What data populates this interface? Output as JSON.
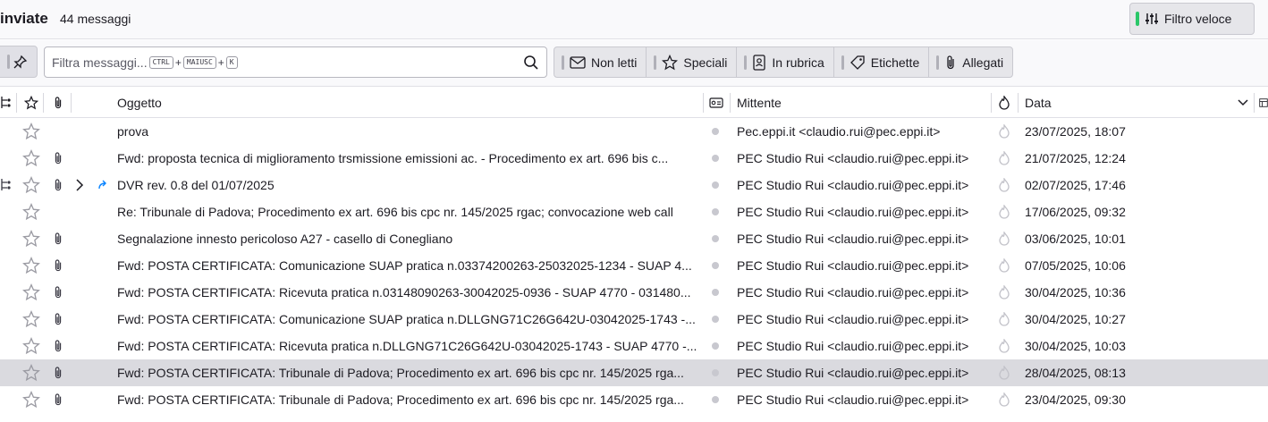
{
  "header": {
    "folder_name": "inviate",
    "message_count": "44 messaggi",
    "quick_filter_label": "Filtro veloce"
  },
  "filterbar": {
    "search_placeholder": "Filtra messaggi...",
    "shortcut_keys": [
      "CTRL",
      "MAIUSC",
      "K"
    ],
    "buttons": [
      {
        "label": "Non letti",
        "icon": "envelope-icon"
      },
      {
        "label": "Speciali",
        "icon": "star-icon"
      },
      {
        "label": "In rubrica",
        "icon": "contact-book-icon"
      },
      {
        "label": "Etichette",
        "icon": "tag-icon"
      },
      {
        "label": "Allegati",
        "icon": "paperclip-icon"
      }
    ]
  },
  "columns": {
    "subject": "Oggetto",
    "sender": "Mittente",
    "date": "Data"
  },
  "messages": [
    {
      "subject": "prova",
      "sender": "Pec.eppi.it <claudio.rui@pec.eppi.it>",
      "date": "23/07/2025, 18:07",
      "attachment": false,
      "selected": false
    },
    {
      "subject": "Fwd: proposta tecnica di miglioramento trsmissione emissioni ac. - Procedimento ex art. 696 bis c...",
      "sender": "PEC Studio Rui <claudio.rui@pec.eppi.it>",
      "date": "21/07/2025, 12:24",
      "attachment": true,
      "selected": false
    },
    {
      "subject": "DVR rev. 0.8 del 01/07/2025",
      "sender": "PEC Studio Rui <claudio.rui@pec.eppi.it>",
      "date": "02/07/2025, 17:46",
      "attachment": true,
      "selected": false,
      "thread": true,
      "forwarded": true
    },
    {
      "subject": "Re: Tribunale di Padova; Procedimento ex art. 696 bis cpc nr. 145/2025 rgac; convocazione web call",
      "sender": "PEC Studio Rui <claudio.rui@pec.eppi.it>",
      "date": "17/06/2025, 09:32",
      "attachment": false,
      "selected": false
    },
    {
      "subject": "Segnalazione innesto pericoloso A27 - casello di Conegliano",
      "sender": "PEC Studio Rui <claudio.rui@pec.eppi.it>",
      "date": "03/06/2025, 10:01",
      "attachment": true,
      "selected": false
    },
    {
      "subject": "Fwd: POSTA CERTIFICATA: Comunicazione SUAP pratica n.03374200263-25032025-1234 - SUAP 4...",
      "sender": "PEC Studio Rui <claudio.rui@pec.eppi.it>",
      "date": "07/05/2025, 10:06",
      "attachment": true,
      "selected": false
    },
    {
      "subject": "Fwd: POSTA CERTIFICATA: Ricevuta pratica n.03148090263-30042025-0936 - SUAP 4770 - 031480...",
      "sender": "PEC Studio Rui <claudio.rui@pec.eppi.it>",
      "date": "30/04/2025, 10:36",
      "attachment": true,
      "selected": false
    },
    {
      "subject": "Fwd: POSTA CERTIFICATA: Comunicazione SUAP pratica n.DLLGNG71C26G642U-03042025-1743 -...",
      "sender": "PEC Studio Rui <claudio.rui@pec.eppi.it>",
      "date": "30/04/2025, 10:27",
      "attachment": true,
      "selected": false
    },
    {
      "subject": "Fwd: POSTA CERTIFICATA: Ricevuta pratica n.DLLGNG71C26G642U-03042025-1743 - SUAP 4770 -...",
      "sender": "PEC Studio Rui <claudio.rui@pec.eppi.it>",
      "date": "30/04/2025, 10:03",
      "attachment": true,
      "selected": false
    },
    {
      "subject": "Fwd: POSTA CERTIFICATA: Tribunale di Padova; Procedimento ex art. 696 bis cpc nr. 145/2025 rga...",
      "sender": "PEC Studio Rui <claudio.rui@pec.eppi.it>",
      "date": "28/04/2025, 08:13",
      "attachment": true,
      "selected": true
    },
    {
      "subject": "Fwd: POSTA CERTIFICATA: Tribunale di Padova; Procedimento ex art. 696 bis cpc nr. 145/2025 rga...",
      "sender": "PEC Studio Rui <claudio.rui@pec.eppi.it>",
      "date": "23/04/2025, 09:30",
      "attachment": true,
      "selected": false
    }
  ]
}
